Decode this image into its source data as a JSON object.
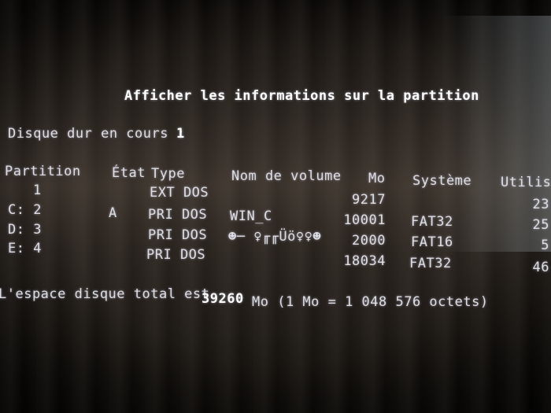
{
  "screen": {
    "title": "Afficher les informations sur la partition",
    "current_disk_label": "Disque dur en cours :",
    "current_disk_value": "1"
  },
  "table": {
    "headers": {
      "partition": "Partition",
      "etat": "État",
      "type": "Type",
      "volume": "Nom de volume",
      "mo": "Mo",
      "systeme": "Système",
      "utilisation": "Utilis"
    },
    "rows": [
      {
        "partition": "1",
        "etat": "",
        "type": "EXT DOS",
        "volume": "",
        "mo": "9217",
        "systeme": "",
        "utilisation": "23"
      },
      {
        "partition": "C: 2",
        "etat": "A",
        "type": "PRI DOS",
        "volume": "WIN_C",
        "mo": "10001",
        "systeme": "FAT32",
        "utilisation": "25"
      },
      {
        "partition": "D: 3",
        "etat": "",
        "type": "PRI DOS",
        "volume": "☻─ ♀╓╓Üö♀♀☻",
        "mo": "2000",
        "systeme": "FAT16",
        "utilisation": "5"
      },
      {
        "partition": "E: 4",
        "etat": "",
        "type": "PRI DOS",
        "volume": "",
        "mo": "18034",
        "systeme": "FAT32",
        "utilisation": "46"
      }
    ]
  },
  "footer": {
    "prefix": "L'espace disque total est",
    "total": "39260",
    "suffix": "Mo (1 Mo = 1 048 576 octets)"
  }
}
